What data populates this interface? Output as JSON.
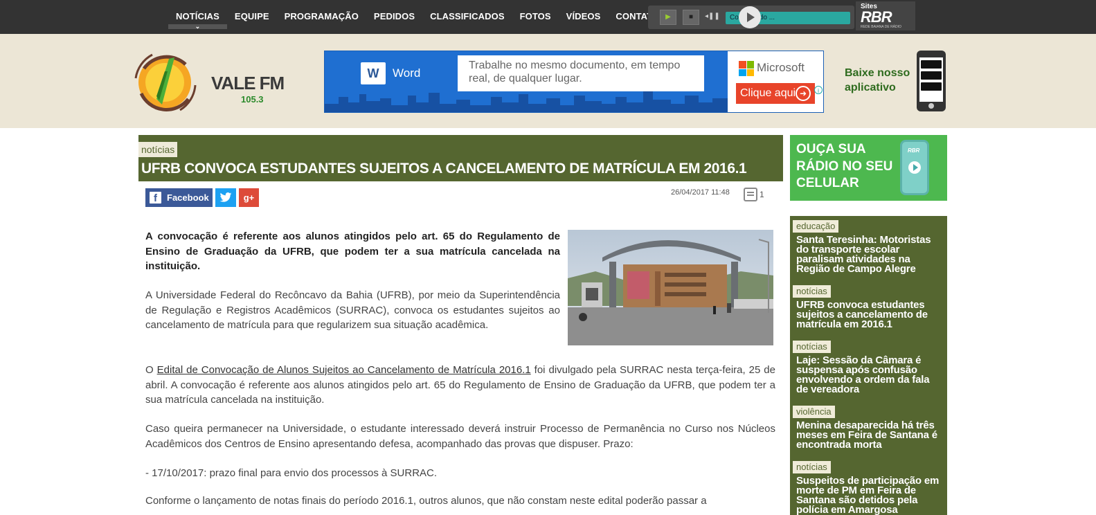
{
  "nav": {
    "items": [
      {
        "label": "NOTÍCIAS",
        "active": true
      },
      {
        "label": "EQUIPE"
      },
      {
        "label": "PROGRAMAÇÃO"
      },
      {
        "label": "PEDIDOS"
      },
      {
        "label": "CLASSIFICADOS"
      },
      {
        "label": "FOTOS"
      },
      {
        "label": "VÍDEOS"
      },
      {
        "label": "CONTATO"
      }
    ],
    "chevron_icon": "chevron-down-icon"
  },
  "player": {
    "status": "Conectando ...",
    "play_icon": "play-icon",
    "stop_icon": "stop-icon",
    "volume_icon": "volume-icon"
  },
  "rbr": {
    "sites_label": "Sites",
    "logo": "RBR",
    "subtitle": "REDE BAIANA DE RÁDIO"
  },
  "header": {
    "logo_name": "VALE FM",
    "logo_freq": "105.3"
  },
  "ad": {
    "product_letter": "W",
    "product": "Word",
    "message": "Trabalhe no mesmo documento, em tempo real, de qualquer lugar.",
    "brand": "Microsoft",
    "cta": "Clique aqui",
    "info_icon": "info-icon",
    "ms_colors": [
      "#f25022",
      "#7fba00",
      "#00a4ef",
      "#ffb900"
    ]
  },
  "app_promo": {
    "text_line1": "Baixe nosso",
    "text_line2": "aplicativo"
  },
  "article": {
    "category": "notícias",
    "title": "UFRB CONVOCA ESTUDANTES SUJEITOS A CANCELAMENTO DE MATRÍCULA EM 2016.1",
    "share": {
      "facebook": "Facebook",
      "twitter_icon": "twitter-icon",
      "gplus_label": "g+"
    },
    "date": "26/04/2017 11:48",
    "comment_count": "1",
    "lead": "A convocação é referente aos alunos atingidos pelo art. 65 do Regulamento de Ensino de Graduação da UFRB, que podem ter a sua matrícula cancelada na instituição.",
    "p1": "A Universidade Federal do Recôncavo da Bahia (UFRB), por meio da Superintendência de Regulação e Registros Acadêmicos (SURRAC), convoca os estudantes sujeitos ao cancelamento de matrícula para que regularizem sua situação acadêmica.",
    "p2_prefix": "O ",
    "p2_link": "Edital de Convocação de Alunos Sujeitos ao Cancelamento de Matrícula 2016.1",
    "p2_suffix": " foi divulgado pela SURRAC nesta terça-feira, 25 de abril. A convocação é referente aos alunos atingidos pelo art. 65 do Regulamento de Ensino de Graduação da UFRB, que podem ter a sua matrícula cancelada na instituição.",
    "p3": "Caso queira permanecer na Universidade, o estudante interessado deverá instruir Processo de Permanência no Curso nos Núcleos Acadêmicos dos Centros de Ensino apresentando defesa, acompanhado das provas que dispuser. Prazo:",
    "p4": "- 17/10/2017: prazo final para envio dos processos à SURRAC.",
    "p5": "Conforme o lançamento de notas finais do período 2016.1, outros alunos, que não constam neste edital poderão passar a"
  },
  "sidebar": {
    "promo_line1": "OUÇA SUA",
    "promo_line2": "RÁDIO NO SEU",
    "promo_line3": "CELULAR",
    "promo_phone_label": "RBR",
    "news": [
      {
        "category": "educação",
        "title": "Santa Teresinha: Motoristas do transporte escolar paralisam atividades na Região de Campo Alegre"
      },
      {
        "category": "notícias",
        "title": "UFRB convoca estudantes sujeitos a cancelamento de matrícula em 2016.1"
      },
      {
        "category": "notícias",
        "title": "Laje: Sessão da Câmara é suspensa após confusão envolvendo a ordem da fala de vereadora"
      },
      {
        "category": "violência",
        "title": "Menina desaparecida há três meses em Feira de Santana é encontrada morta"
      },
      {
        "category": "notícias",
        "title": "Suspeitos de participação em morte de PM em Feira de Santana são detidos pela polícia em Amargosa"
      }
    ]
  }
}
